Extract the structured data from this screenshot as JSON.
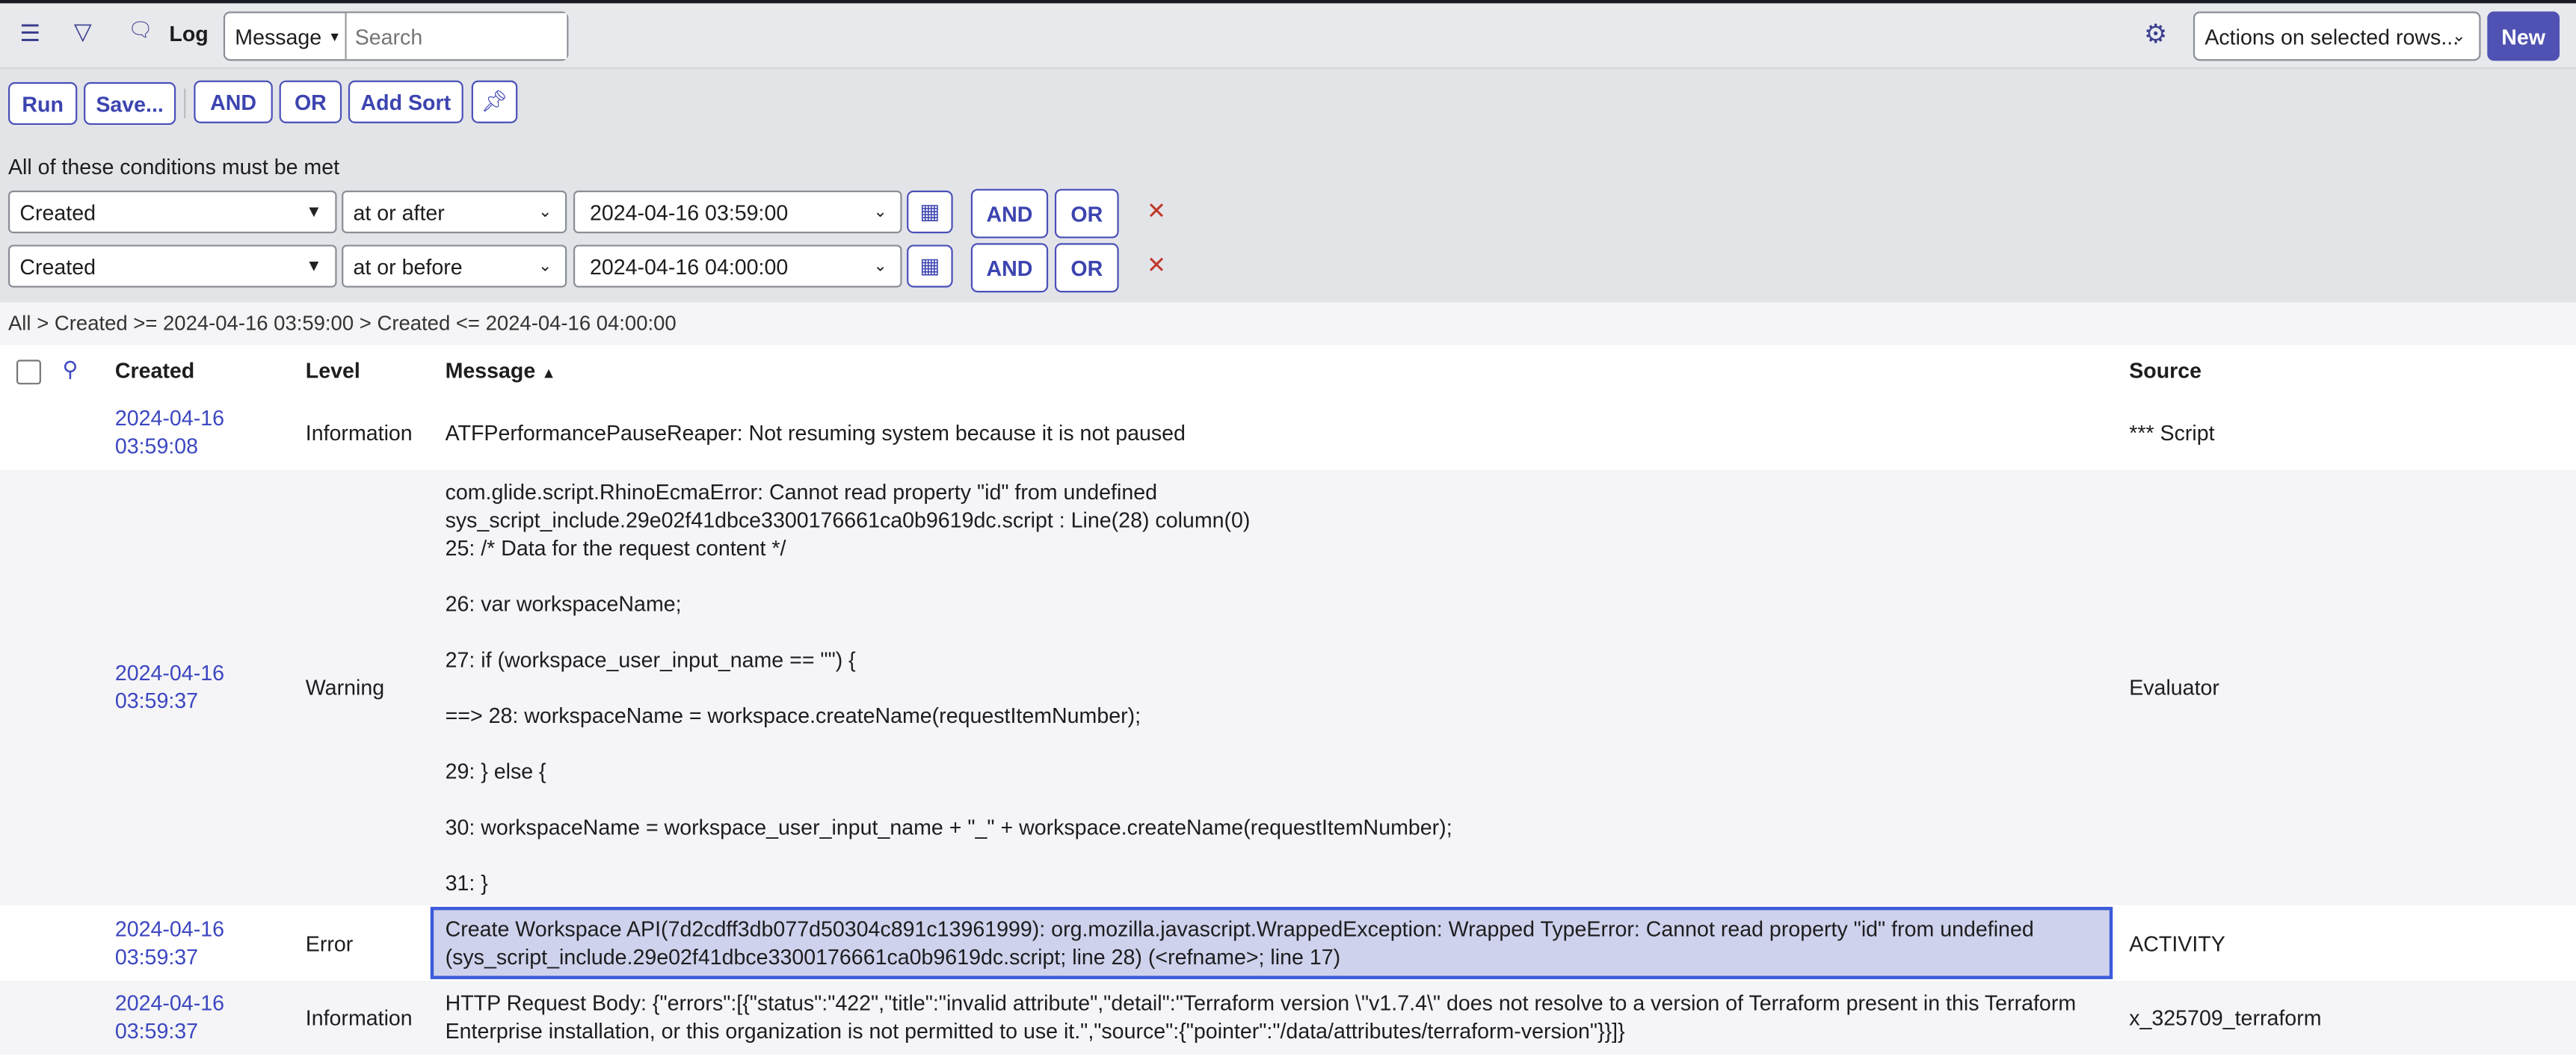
{
  "header": {
    "title": "Log",
    "search_field": "Message",
    "search_placeholder": "Search",
    "actions_select": "Actions on selected rows...",
    "new_label": "New",
    "icons": [
      "menu-icon",
      "filter-icon",
      "chat-icon",
      "gear-icon"
    ]
  },
  "toolbar": {
    "run": "Run",
    "save": "Save...",
    "and": "AND",
    "or": "OR",
    "add_sort": "Add Sort",
    "pin_icon": "pin-icon"
  },
  "conditions": {
    "heading": "All of these conditions must be met",
    "rows": [
      {
        "field": "Created",
        "operator": "at or after",
        "value": "2024-04-16 03:59:00",
        "and": "AND",
        "or": "OR"
      },
      {
        "field": "Created",
        "operator": "at or before",
        "value": "2024-04-16 04:00:00",
        "and": "AND",
        "or": "OR"
      }
    ]
  },
  "breadcrumb": {
    "all": "All",
    "sep": ">",
    "c1": "Created >= 2024-04-16 03:59:00",
    "c2": "Created <= 2024-04-16 04:00:00"
  },
  "table": {
    "headers": {
      "created": "Created",
      "level": "Level",
      "message": "Message",
      "source": "Source"
    },
    "rows": [
      {
        "date": "2024-04-16",
        "time": "03:59:08",
        "level": "Information",
        "message": "ATFPerformancePauseReaper: Not resuming system because it is not paused",
        "source": "*** Script"
      },
      {
        "date": "2024-04-16",
        "time": "03:59:37",
        "level": "Warning",
        "message": "com.glide.script.RhinoEcmaError: Cannot read property \"id\" from undefined\nsys_script_include.29e02f41dbce3300176661ca0b9619dc.script : Line(28) column(0)\n25: /* Data for the request content */\n\n26: var workspaceName;\n\n27: if (workspace_user_input_name == \"\") {\n\n==> 28: workspaceName = workspace.createName(requestItemNumber);\n\n29: } else {\n\n30: workspaceName = workspace_user_input_name + \"_\" + workspace.createName(requestItemNumber);\n\n31: }",
        "source": "Evaluator"
      },
      {
        "date": "2024-04-16",
        "time": "03:59:37",
        "level": "Error",
        "message": "Create Workspace API(7d2cdff3db077d50304c891c13961999): org.mozilla.javascript.WrappedException: Wrapped TypeError: Cannot read property \"id\" from undefined\n(sys_script_include.29e02f41dbce3300176661ca0b9619dc.script; line 28) (<refname>; line 17)",
        "source": "ACTIVITY"
      },
      {
        "date": "2024-04-16",
        "time": "03:59:37",
        "level": "Information",
        "message": "HTTP Request Body: {\"errors\":[{\"status\":\"422\",\"title\":\"invalid attribute\",\"detail\":\"Terraform version \\\"v1.7.4\\\" does not resolve to a version of Terraform present in this Terraform\nEnterprise installation, or this organization is not permitted to use it.\",\"source\":{\"pointer\":\"/data/attributes/terraform-version\"}}]}",
        "source": "x_325709_terraform"
      }
    ]
  },
  "colors": {
    "accent": "#4f52b2",
    "link": "#3c47c0",
    "selection": "#cfd2ec",
    "selection_border": "#3b5bdb",
    "remove": "#c0392b"
  }
}
